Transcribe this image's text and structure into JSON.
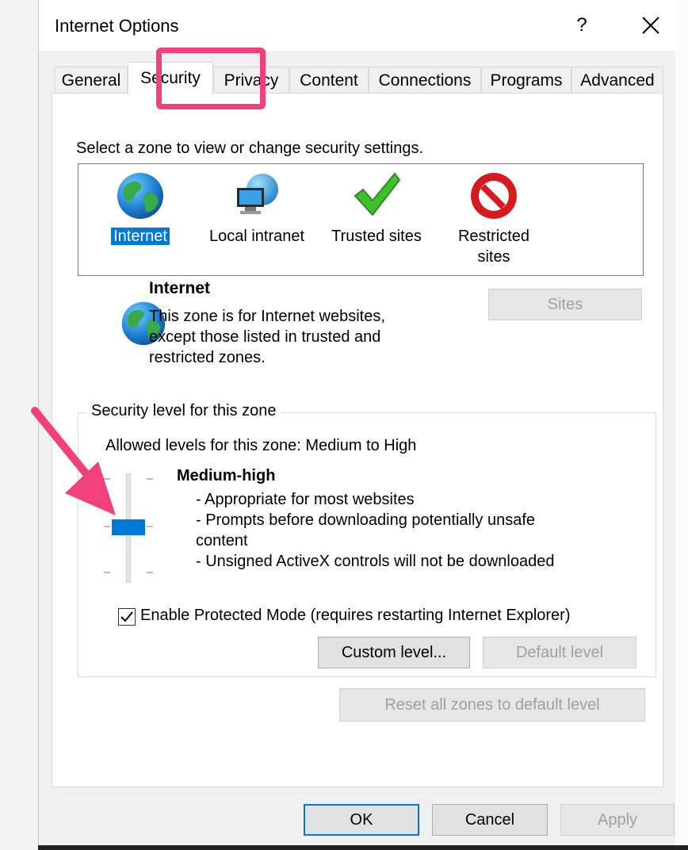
{
  "window": {
    "title": "Internet Options"
  },
  "tabs": [
    {
      "label": "General"
    },
    {
      "label": "Security",
      "active": true
    },
    {
      "label": "Privacy"
    },
    {
      "label": "Content"
    },
    {
      "label": "Connections"
    },
    {
      "label": "Programs"
    },
    {
      "label": "Advanced"
    }
  ],
  "security": {
    "select_zone_text": "Select a zone to view or change security settings.",
    "zones": [
      {
        "name": "Internet",
        "icon": "globe-icon",
        "selected": true
      },
      {
        "name": "Local intranet",
        "icon": "intranet-icon"
      },
      {
        "name": "Trusted sites",
        "icon": "checkmark-icon"
      },
      {
        "name": "Restricted sites",
        "line1": "Restricted",
        "line2": "sites",
        "icon": "restricted-icon"
      }
    ],
    "zone_info": {
      "title": "Internet",
      "desc_line1": "This zone is for Internet websites,",
      "desc_line2": "except those listed in trusted and",
      "desc_line3": "restricted zones."
    },
    "sites_button": "Sites",
    "level_group": {
      "title": "Security level for this zone",
      "allowed": "Allowed levels for this zone: Medium to High",
      "level_name": "Medium-high",
      "bullet1": "- Appropriate for most websites",
      "bullet2": "- Prompts before downloading potentially unsafe",
      "bullet2_cont": "content",
      "bullet3": "- Unsigned ActiveX controls will not be downloaded",
      "slider_level": 2,
      "slider_levels": 3
    },
    "protected_mode": {
      "label": "Enable Protected Mode (requires restarting Internet Explorer)",
      "checked": true
    },
    "custom_level_button": "Custom level...",
    "default_level_button": "Default level",
    "reset_button": "Reset all zones to default level"
  },
  "footer": {
    "ok": "OK",
    "cancel": "Cancel",
    "apply": "Apply"
  },
  "colors": {
    "accent": "#0078d7",
    "highlight": "#f0417c"
  }
}
